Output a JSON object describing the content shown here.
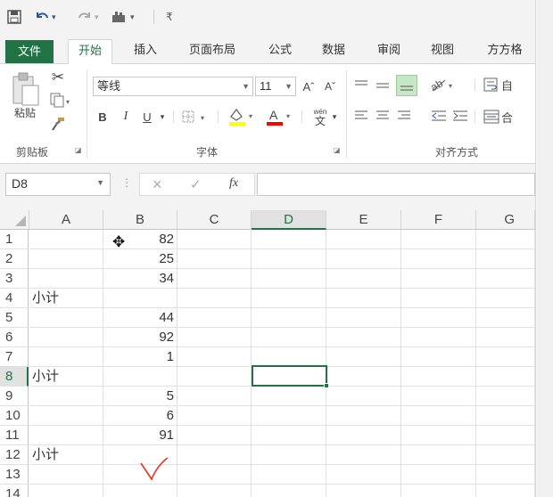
{
  "qat": {
    "save_icon": "save-icon",
    "undo_icon": "undo-icon",
    "redo_icon": "redo-icon",
    "extra_icon": "touch-mode-icon",
    "customize_icon": "customize-icon"
  },
  "tabs": [
    "文件",
    "开始",
    "插入",
    "页面布局",
    "公式",
    "数据",
    "审阅",
    "视图",
    "方方格"
  ],
  "ribbon": {
    "paste_label": "粘贴",
    "clipboard_label": "剪贴板",
    "font_label": "字体",
    "align_label": "对齐方式",
    "font_name": "等线",
    "font_size": "11",
    "bold": "B",
    "italic": "I",
    "underline": "U",
    "grow": "Aˆ",
    "shrink": "Aˇ",
    "wen": "wén",
    "wen_char": "文",
    "wrap_label": "自",
    "merge_label": "合",
    "font_color": "#ff0000",
    "fill_color": "#ffff00",
    "accent": "#217346"
  },
  "formula_bar": {
    "name_box": "D8",
    "cancel": "×",
    "enter": "✓",
    "fx": "fx",
    "value": ""
  },
  "columns": [
    "A",
    "B",
    "C",
    "D",
    "E",
    "F",
    "G"
  ],
  "rows": [
    {
      "n": "1",
      "a": "",
      "b": "82"
    },
    {
      "n": "2",
      "a": "",
      "b": "25"
    },
    {
      "n": "3",
      "a": "",
      "b": "34"
    },
    {
      "n": "4",
      "a": "小计",
      "b": ""
    },
    {
      "n": "5",
      "a": "",
      "b": "44"
    },
    {
      "n": "6",
      "a": "",
      "b": "92"
    },
    {
      "n": "7",
      "a": "",
      "b": "1"
    },
    {
      "n": "8",
      "a": "小计",
      "b": ""
    },
    {
      "n": "9",
      "a": "",
      "b": "5"
    },
    {
      "n": "10",
      "a": "",
      "b": "6"
    },
    {
      "n": "11",
      "a": "",
      "b": "91"
    },
    {
      "n": "12",
      "a": "小计",
      "b": ""
    },
    {
      "n": "13",
      "a": "",
      "b": ""
    },
    {
      "n": "14",
      "a": "",
      "b": ""
    }
  ],
  "selected_cell": "D8"
}
